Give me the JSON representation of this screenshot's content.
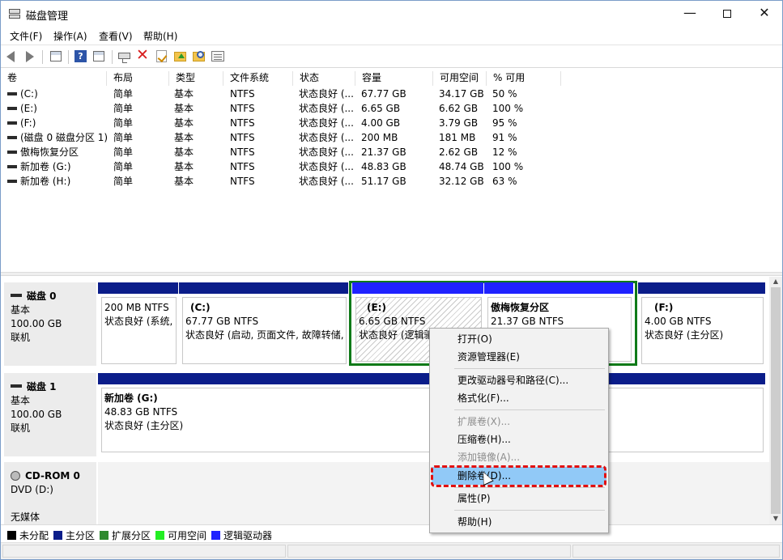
{
  "window": {
    "title": "磁盘管理"
  },
  "menubar": {
    "items": [
      "文件(F)",
      "操作(A)",
      "查看(V)",
      "帮助(H)"
    ]
  },
  "table": {
    "headers": [
      "卷",
      "布局",
      "类型",
      "文件系统",
      "状态",
      "容量",
      "可用空间",
      "% 可用"
    ],
    "rows": [
      [
        "(C:)",
        "简单",
        "基本",
        "NTFS",
        "状态良好 (...",
        "67.77 GB",
        "34.17 GB",
        "50 %"
      ],
      [
        "(E:)",
        "简单",
        "基本",
        "NTFS",
        "状态良好 (...",
        "6.65 GB",
        "6.62 GB",
        "100 %"
      ],
      [
        "(F:)",
        "简单",
        "基本",
        "NTFS",
        "状态良好 (...",
        "4.00 GB",
        "3.79 GB",
        "95 %"
      ],
      [
        "(磁盘 0 磁盘分区 1)",
        "简单",
        "基本",
        "NTFS",
        "状态良好 (...",
        "200 MB",
        "181 MB",
        "91 %"
      ],
      [
        "傲梅恢复分区",
        "简单",
        "基本",
        "NTFS",
        "状态良好 (...",
        "21.37 GB",
        "2.62 GB",
        "12 %"
      ],
      [
        "新加卷 (G:)",
        "简单",
        "基本",
        "NTFS",
        "状态良好 (...",
        "48.83 GB",
        "48.74 GB",
        "100 %"
      ],
      [
        "新加卷 (H:)",
        "简单",
        "基本",
        "NTFS",
        "状态良好 (...",
        "51.17 GB",
        "32.12 GB",
        "63 %"
      ]
    ]
  },
  "disks": {
    "disk0": {
      "name": "磁盘 0",
      "type": "基本",
      "size": "100.00 GB",
      "state": "联机",
      "p1": {
        "size": "200 MB NTFS",
        "status": "状态良好 (系统,"
      },
      "p2": {
        "name": "(C:)",
        "size": "67.77 GB NTFS",
        "status": "状态良好 (启动, 页面文件, 故障转储,"
      },
      "p3": {
        "name": "(E:)",
        "size": "6.65 GB NTFS",
        "status": "状态良好 (逻辑驱"
      },
      "p4": {
        "name": "傲梅恢复分区",
        "size": "21.37 GB NTFS"
      },
      "p5": {
        "name": "(F:)",
        "size": "4.00 GB NTFS",
        "status": "状态良好 (主分区)"
      }
    },
    "disk1": {
      "name": "磁盘 1",
      "type": "基本",
      "size": "100.00 GB",
      "state": "联机",
      "p1": {
        "name": "新加卷 (G:)",
        "size": "48.83 GB NTFS",
        "status": "状态良好 (主分区)"
      }
    },
    "cdrom": {
      "name": "CD-ROM 0",
      "drive": "DVD (D:)",
      "state": "无媒体"
    }
  },
  "legend": [
    "未分配",
    "主分区",
    "扩展分区",
    "可用空间",
    "逻辑驱动器"
  ],
  "legend_colors": [
    "#000000",
    "#0b1d8a",
    "#2f8a2f",
    "#22ee22",
    "#1f22ff"
  ],
  "context_menu": {
    "open": "打开(O)",
    "explorer": "资源管理器(E)",
    "change_letter": "更改驱动器号和路径(C)...",
    "format": "格式化(F)...",
    "extend": "扩展卷(X)...",
    "shrink": "压缩卷(H)...",
    "mirror": "添加镜像(A)...",
    "delete": "删除卷(D)...",
    "properties": "属性(P)",
    "help": "帮助(H)"
  }
}
